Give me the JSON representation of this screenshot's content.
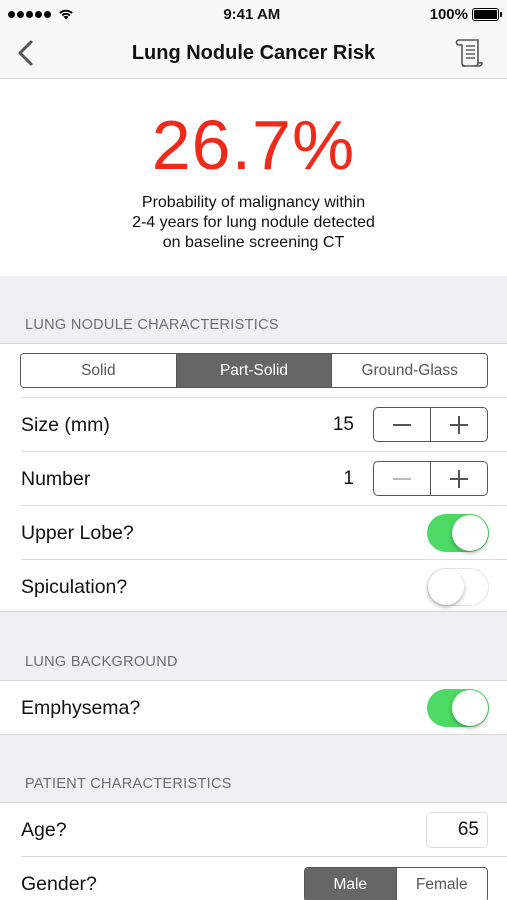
{
  "status_bar": {
    "time": "9:41 AM",
    "battery": "100%"
  },
  "nav": {
    "title": "Lung Nodule Cancer Risk"
  },
  "result": {
    "value": "26.7%",
    "description": "Probability of malignancy within\n2-4 years for lung nodule detected\non baseline screening CT",
    "color": "#ee2a1a"
  },
  "nodule": {
    "header": "LUNG NODULE CHARACTERISTICS",
    "type_options": [
      "Solid",
      "Part-Solid",
      "Ground-Glass"
    ],
    "type_selected": "Part-Solid",
    "size_label": "Size (mm)",
    "size_value": "15",
    "number_label": "Number",
    "number_value": "1",
    "upper_lobe_label": "Upper Lobe?",
    "upper_lobe": true,
    "spiculation_label": "Spiculation?",
    "spiculation": false
  },
  "background": {
    "header": "LUNG BACKGROUND",
    "emphysema_label": "Emphysema?",
    "emphysema": true
  },
  "patient": {
    "header": "PATIENT CHARACTERISTICS",
    "age_label": "Age?",
    "age_value": "65",
    "gender_label": "Gender?",
    "gender_options": [
      "Male",
      "Female"
    ],
    "gender_selected": "Male"
  },
  "colors": {
    "toggle_on": "#4cd964",
    "segment_active": "#666666"
  }
}
